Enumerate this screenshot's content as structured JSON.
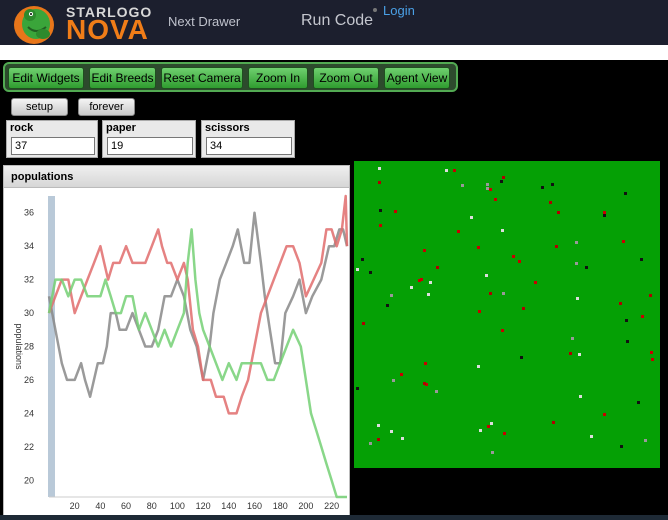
{
  "header": {
    "logo": {
      "text_top": "STARLOGO",
      "text_bottom": "NOVA"
    },
    "nav": {
      "next_drawer": "Next Drawer",
      "run_code": "Run Code",
      "login": "Login"
    }
  },
  "toolbar": {
    "buttons": [
      {
        "label": "Edit Widgets"
      },
      {
        "label": "Edit Breeds"
      },
      {
        "label": "Reset Camera"
      },
      {
        "label": "Zoom In"
      },
      {
        "label": "Zoom Out"
      },
      {
        "label": "Agent View"
      }
    ]
  },
  "controls": {
    "setup_label": "setup",
    "forever_label": "forever"
  },
  "widgets": {
    "rock": {
      "label": "rock",
      "value": "37"
    },
    "paper": {
      "label": "paper",
      "value": "19"
    },
    "scissors": {
      "label": "scissors",
      "value": "34"
    }
  },
  "chart_panel": {
    "title": "populations"
  },
  "colors": {
    "world": "#05a005",
    "toolbar_button": "#45b845",
    "rock_series": "#888888",
    "paper_series": "#e06c6c",
    "scissors_series": "#74d074"
  },
  "chart_data": {
    "type": "line",
    "title": "",
    "xlabel": "",
    "ylabel": "populations",
    "xlim": [
      0,
      232
    ],
    "ylim": [
      19,
      37
    ],
    "xticks": [
      20,
      40,
      60,
      80,
      100,
      120,
      140,
      160,
      180,
      200,
      220
    ],
    "yticks": [
      20,
      22,
      24,
      26,
      28,
      30,
      32,
      34,
      36
    ],
    "series": [
      {
        "color": "#888888",
        "points": [
          [
            0,
            31
          ],
          [
            5,
            29
          ],
          [
            10,
            27
          ],
          [
            14,
            26
          ],
          [
            20,
            26
          ],
          [
            25,
            27
          ],
          [
            28,
            26
          ],
          [
            32,
            25
          ],
          [
            38,
            27
          ],
          [
            42,
            27
          ],
          [
            45,
            28
          ],
          [
            48,
            30
          ],
          [
            52,
            30
          ],
          [
            55,
            29
          ],
          [
            60,
            29
          ],
          [
            65,
            30
          ],
          [
            70,
            29
          ],
          [
            75,
            28
          ],
          [
            80,
            28
          ],
          [
            85,
            29
          ],
          [
            90,
            31
          ],
          [
            95,
            31
          ],
          [
            100,
            32
          ],
          [
            105,
            31
          ],
          [
            110,
            29
          ],
          [
            115,
            28
          ],
          [
            120,
            26
          ],
          [
            125,
            28
          ],
          [
            128,
            30
          ],
          [
            133,
            32
          ],
          [
            138,
            33
          ],
          [
            143,
            34
          ],
          [
            147,
            35
          ],
          [
            152,
            33
          ],
          [
            156,
            33
          ],
          [
            160,
            36
          ],
          [
            165,
            33
          ],
          [
            168,
            31
          ],
          [
            172,
            29
          ],
          [
            176,
            27
          ],
          [
            180,
            27
          ],
          [
            184,
            30
          ],
          [
            190,
            31
          ],
          [
            195,
            32
          ],
          [
            200,
            30
          ],
          [
            205,
            31
          ],
          [
            212,
            32
          ],
          [
            218,
            34
          ],
          [
            222,
            34
          ],
          [
            226,
            35
          ],
          [
            229,
            35
          ],
          [
            232,
            34
          ]
        ]
      },
      {
        "color": "#e06c6c",
        "points": [
          [
            0,
            30
          ],
          [
            5,
            31
          ],
          [
            10,
            32
          ],
          [
            15,
            32
          ],
          [
            20,
            30
          ],
          [
            25,
            31
          ],
          [
            30,
            32
          ],
          [
            35,
            33
          ],
          [
            40,
            34
          ],
          [
            43,
            33
          ],
          [
            46,
            32
          ],
          [
            50,
            33
          ],
          [
            55,
            33
          ],
          [
            60,
            34
          ],
          [
            65,
            33
          ],
          [
            70,
            33
          ],
          [
            75,
            33
          ],
          [
            80,
            34
          ],
          [
            85,
            35
          ],
          [
            88,
            34
          ],
          [
            92,
            33
          ],
          [
            95,
            33
          ],
          [
            100,
            32
          ],
          [
            105,
            33
          ],
          [
            108,
            32
          ],
          [
            112,
            29
          ],
          [
            116,
            28
          ],
          [
            120,
            26
          ],
          [
            126,
            26
          ],
          [
            130,
            25
          ],
          [
            136,
            25
          ],
          [
            140,
            24
          ],
          [
            146,
            24
          ],
          [
            150,
            25
          ],
          [
            155,
            26
          ],
          [
            160,
            28
          ],
          [
            165,
            30
          ],
          [
            170,
            31
          ],
          [
            175,
            32
          ],
          [
            180,
            33
          ],
          [
            185,
            34
          ],
          [
            190,
            34
          ],
          [
            195,
            33
          ],
          [
            200,
            31
          ],
          [
            206,
            32
          ],
          [
            212,
            33
          ],
          [
            216,
            35
          ],
          [
            220,
            35
          ],
          [
            224,
            34
          ],
          [
            228,
            35
          ],
          [
            231,
            37
          ],
          [
            232,
            34
          ]
        ]
      },
      {
        "color": "#74d074",
        "points": [
          [
            0,
            30
          ],
          [
            5,
            32
          ],
          [
            10,
            32
          ],
          [
            15,
            31
          ],
          [
            20,
            32
          ],
          [
            25,
            32
          ],
          [
            30,
            31
          ],
          [
            35,
            31
          ],
          [
            40,
            31
          ],
          [
            44,
            32
          ],
          [
            48,
            31
          ],
          [
            52,
            30
          ],
          [
            56,
            30
          ],
          [
            60,
            31
          ],
          [
            65,
            31
          ],
          [
            70,
            29
          ],
          [
            75,
            30
          ],
          [
            80,
            29
          ],
          [
            85,
            28
          ],
          [
            90,
            29
          ],
          [
            95,
            28
          ],
          [
            100,
            29
          ],
          [
            105,
            30
          ],
          [
            108,
            33
          ],
          [
            111,
            35
          ],
          [
            114,
            32
          ],
          [
            117,
            30
          ],
          [
            120,
            29
          ],
          [
            125,
            28
          ],
          [
            130,
            27
          ],
          [
            135,
            26
          ],
          [
            140,
            27
          ],
          [
            146,
            26
          ],
          [
            150,
            27
          ],
          [
            156,
            27
          ],
          [
            160,
            27
          ],
          [
            165,
            27
          ],
          [
            170,
            26
          ],
          [
            175,
            26
          ],
          [
            180,
            27
          ],
          [
            185,
            28
          ],
          [
            190,
            29
          ],
          [
            196,
            28
          ],
          [
            200,
            26
          ],
          [
            204,
            24
          ],
          [
            208,
            23
          ],
          [
            212,
            22
          ],
          [
            216,
            21
          ],
          [
            220,
            20
          ],
          [
            224,
            19
          ],
          [
            228,
            19
          ],
          [
            232,
            19
          ]
        ]
      }
    ]
  }
}
